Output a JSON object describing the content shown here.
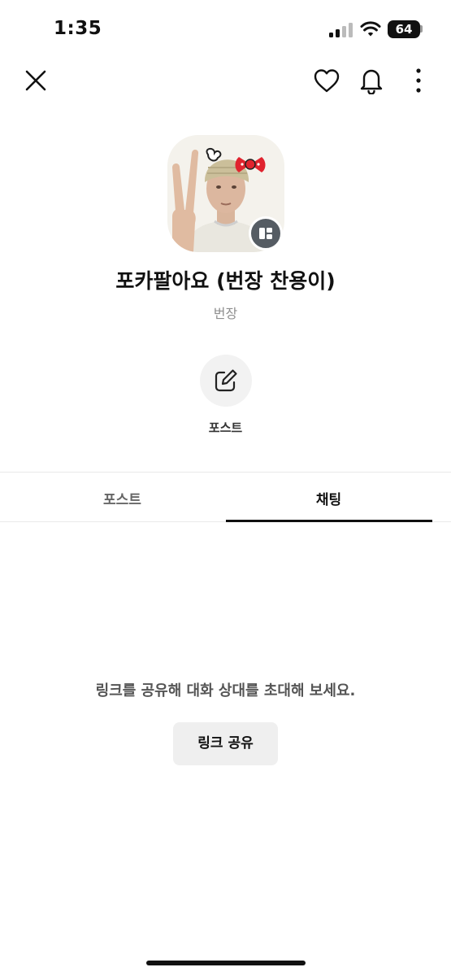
{
  "status_bar": {
    "time": "1:35",
    "battery_level": "64",
    "icons": [
      "cellular-signal-icon",
      "wifi-icon",
      "battery-icon"
    ]
  },
  "nav": {
    "icons": [
      "close-icon",
      "heart-icon",
      "bell-icon",
      "more-vertical-icon"
    ]
  },
  "profile": {
    "name": "포카팔아요 (번장 찬용이)",
    "handle": "번장",
    "avatar_badge_icon": "layout-icon"
  },
  "actions": {
    "post_label": "포스트",
    "post_icon": "edit-icon"
  },
  "tabs": [
    {
      "label": "포스트",
      "active": false
    },
    {
      "label": "채팅",
      "active": true
    }
  ],
  "chat_empty": {
    "message": "링크를 공유해 대화 상대를 초대해 보세요.",
    "share_button": "링크 공유"
  },
  "colors": {
    "background": "#ffffff",
    "text": "#111111",
    "muted": "#8e8e8e",
    "button_bg": "#efefef",
    "badge": "#555c63"
  }
}
